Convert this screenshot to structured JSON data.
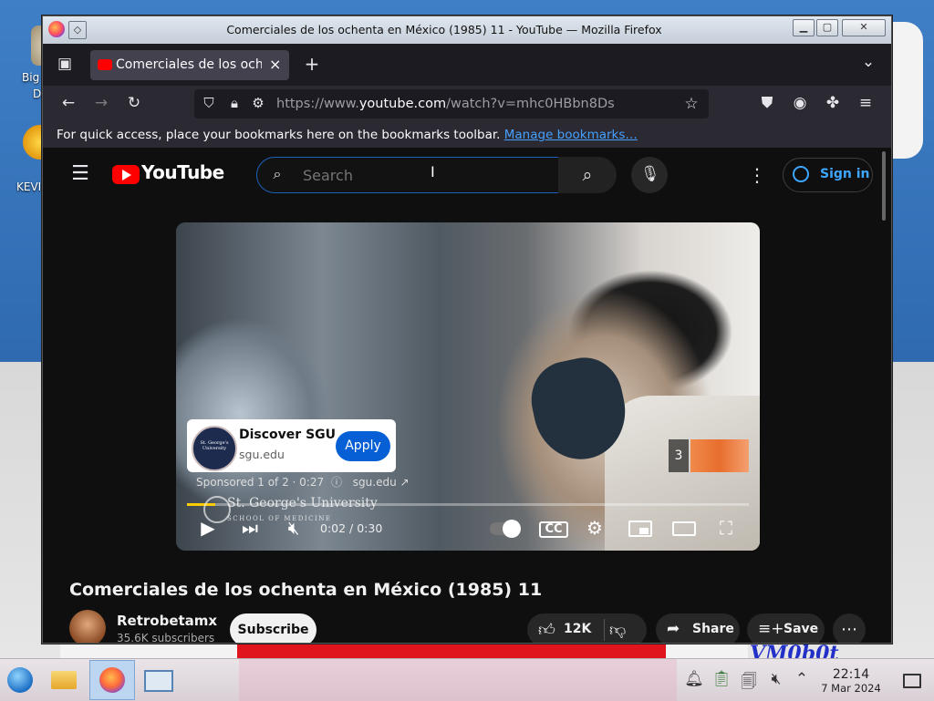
{
  "window": {
    "title": "Comerciales de los ochenta en México (1985) 11 - YouTube — Mozilla Firefox",
    "btn_min": "▁",
    "btn_max": "▢",
    "btn_close": "✕"
  },
  "desktop": {
    "icon1_label": "Big",
    "icon1_label2": "D",
    "icon2_label": "KEVI",
    "corner_text": "VM0b0t"
  },
  "tabs": [
    {
      "label": "Comerciales de los ochenta",
      "favicon": "youtube-icon",
      "close": "×"
    }
  ],
  "tabbar": {
    "new_tab": "+",
    "list_tabs": "⌄"
  },
  "navbar": {
    "url_prefix": "https://www.",
    "url_host": "youtube.com",
    "url_path": "/watch?v=mhc0HBbn8Ds"
  },
  "bookmarks_bar": {
    "message": "For quick access, place your bookmarks here on the bookmarks toolbar.",
    "link": "Manage bookmarks…"
  },
  "youtube": {
    "logo_text": "YouTube",
    "search_placeholder": "Search",
    "signin": "Sign in",
    "ad": {
      "title": "Discover SGU",
      "domain": "sgu.edu",
      "apply": "Apply",
      "sponsored": "Sponsored 1 of 2 · 0:27",
      "sponsor_link": "sgu.edu",
      "logo_text": "St. George's University",
      "next_count": "3"
    },
    "player": {
      "watermark": "St. George's University",
      "watermark_sub": "SCHOOL OF MEDICINE",
      "time": "0:02 / 0:30",
      "progress": 0.05
    },
    "video_title": "Comerciales de los ochenta en México (1985) 11",
    "channel": "Retrobetamx",
    "subscribers": "35.6K subscribers",
    "subscribe": "Subscribe",
    "likes": "12K",
    "share": "Share",
    "save": "Save"
  },
  "taskbar": {
    "time": "22:14",
    "date": "7 Mar 2024"
  }
}
